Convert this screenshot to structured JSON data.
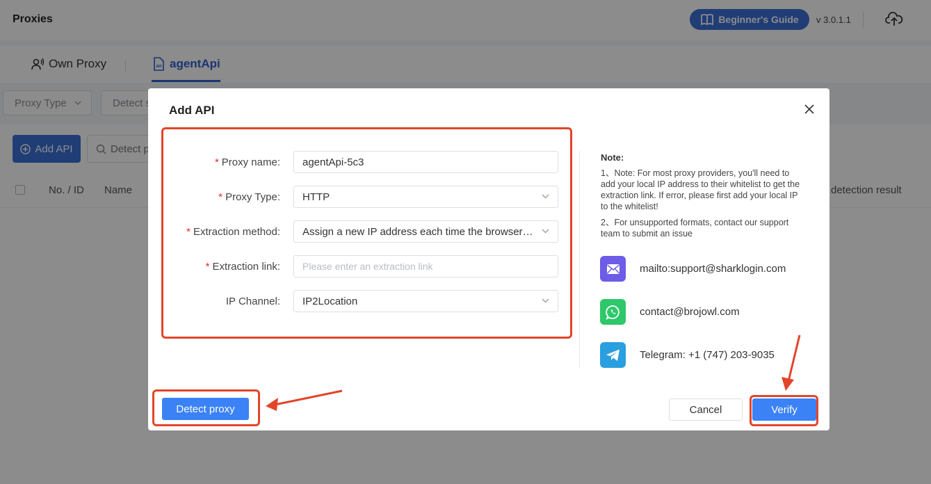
{
  "app": {
    "title": "Proxies",
    "guide_label": "Beginner's Guide",
    "version": "v 3.0.1.1"
  },
  "tabs": [
    {
      "label": "Own Proxy",
      "active": false
    },
    {
      "label": "agentApi",
      "active": true
    }
  ],
  "filters": {
    "proxy_type_placeholder": "Proxy Type",
    "detect_placeholder": "Detect s"
  },
  "actions": {
    "add_api_label": "Add API",
    "detect_label": "Detect p"
  },
  "table": {
    "columns": [
      "No. / ID",
      "Name",
      "detection result"
    ]
  },
  "modal": {
    "title": "Add API",
    "fields": [
      {
        "label": "Proxy name:",
        "required": true,
        "value": "agentApi-5c3",
        "type": "text"
      },
      {
        "label": "Proxy Type:",
        "required": true,
        "value": "HTTP",
        "type": "select"
      },
      {
        "label": "Extraction method:",
        "required": true,
        "value": "Assign a new IP address each time the browser l...",
        "type": "select"
      },
      {
        "label": "Extraction link:",
        "required": true,
        "value": "",
        "placeholder": "Please enter an extraction link",
        "type": "text"
      },
      {
        "label": "IP Channel:",
        "required": false,
        "value": "IP2Location",
        "type": "select"
      }
    ],
    "note": {
      "title": "Note:",
      "line1": "1、Note: For most proxy providers, you'll need to add your local IP address to their whitelist to get the extraction link. If error, please first add your local IP to the whitelist!",
      "line2": "2、For unsupported formats, contact our support team to submit an issue"
    },
    "contacts": [
      {
        "icon": "mail-icon",
        "text": "mailto:support@sharklogin.com",
        "color": "#6c5ce7"
      },
      {
        "icon": "whatsapp-icon",
        "text": "contact@brojowl.com",
        "color": "#2ec86a"
      },
      {
        "icon": "telegram-icon",
        "text": "Telegram: +1 (747) 203-9035",
        "color": "#2a9fe0"
      }
    ],
    "buttons": {
      "detect": "Detect proxy",
      "cancel": "Cancel",
      "verify": "Verify"
    }
  },
  "colors": {
    "primary": "#3b82f6",
    "annotation": "#e2452a",
    "required": "#e02b2b"
  }
}
